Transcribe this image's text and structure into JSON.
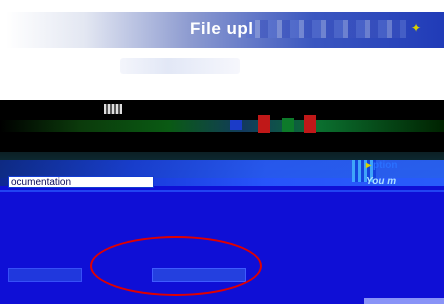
{
  "header": {
    "title": "File upl",
    "title_glyph": "✦"
  },
  "form": {
    "input_value": "ocumentation"
  },
  "options": {
    "link_label": "ption",
    "note": "You m"
  },
  "buttons": {
    "left_label": "",
    "upload_label": ""
  },
  "colors": {
    "page_bg": "#0f0fd6",
    "toolbar": "#000000",
    "highlight": "#e00000"
  }
}
